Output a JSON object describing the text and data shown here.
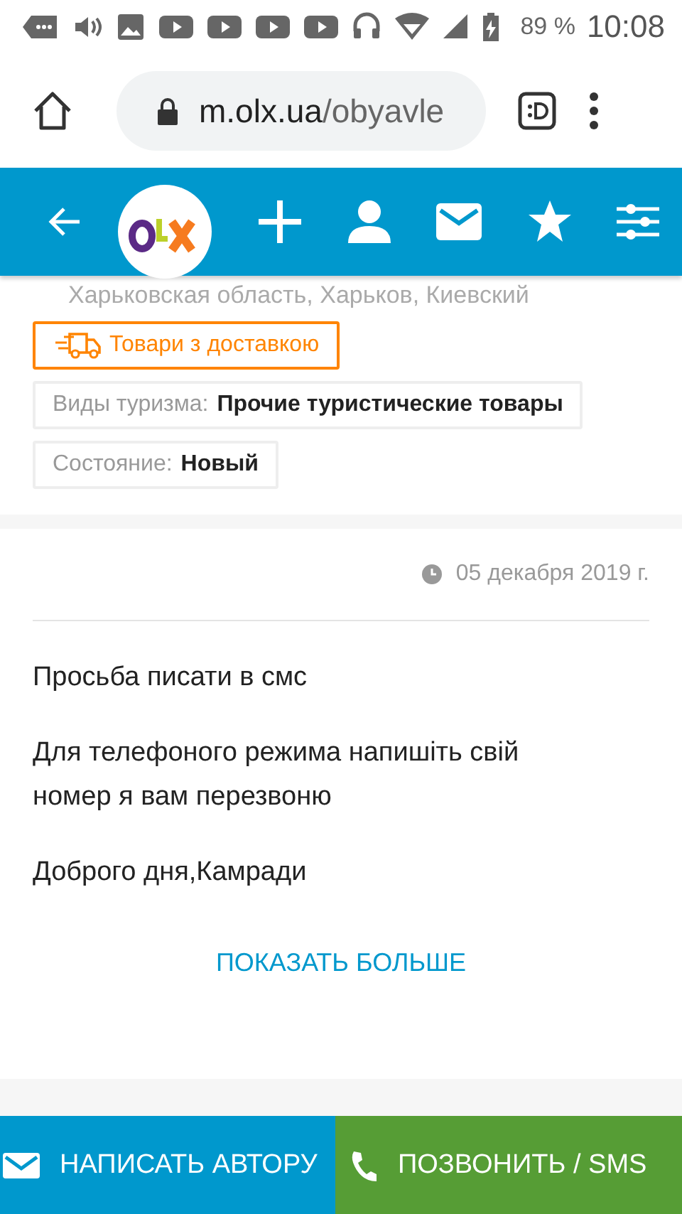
{
  "status_bar": {
    "battery": "89 %",
    "time": "10:08"
  },
  "browser": {
    "url": "m.olx.ua/obyavle"
  },
  "location": "Харьковская область, Харьков, Киевский",
  "tags": [
    {
      "kind": "delivery",
      "label": "Товари з доставкою"
    },
    {
      "kind": "param",
      "label": "Виды туризма:",
      "value": "Прочие туристические товары"
    },
    {
      "kind": "param",
      "label": "Состояние:",
      "value": "Новый"
    }
  ],
  "date": "05 декабря 2019 г.",
  "description": [
    "Просьба писати в смс",
    "Для телефоного режима напишіть свій номер я вам перезвоню",
    "Доброго дня,Камради"
  ],
  "show_more": "ПОКАЗАТЬ БОЛЬШЕ",
  "actions": [
    {
      "kind": "message",
      "label": "НАПИСАТЬ АВТОРУ"
    },
    {
      "kind": "call",
      "label": "ПОЗВОНИТЬ / SMS"
    }
  ]
}
